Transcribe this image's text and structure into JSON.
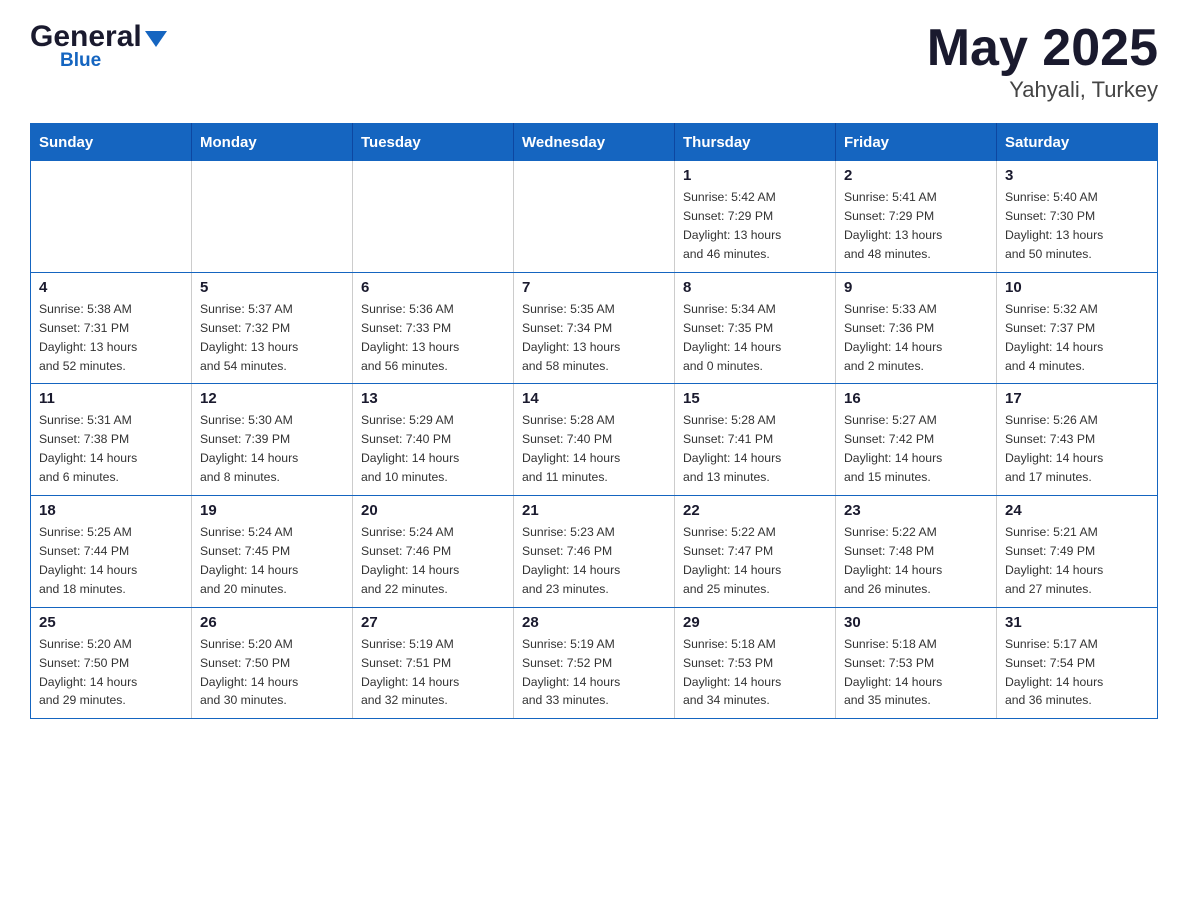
{
  "header": {
    "logo_general": "General",
    "logo_blue": "Blue",
    "month": "May 2025",
    "location": "Yahyali, Turkey"
  },
  "days_of_week": [
    "Sunday",
    "Monday",
    "Tuesday",
    "Wednesday",
    "Thursday",
    "Friday",
    "Saturday"
  ],
  "weeks": [
    [
      {
        "day": "",
        "info": ""
      },
      {
        "day": "",
        "info": ""
      },
      {
        "day": "",
        "info": ""
      },
      {
        "day": "",
        "info": ""
      },
      {
        "day": "1",
        "info": "Sunrise: 5:42 AM\nSunset: 7:29 PM\nDaylight: 13 hours\nand 46 minutes."
      },
      {
        "day": "2",
        "info": "Sunrise: 5:41 AM\nSunset: 7:29 PM\nDaylight: 13 hours\nand 48 minutes."
      },
      {
        "day": "3",
        "info": "Sunrise: 5:40 AM\nSunset: 7:30 PM\nDaylight: 13 hours\nand 50 minutes."
      }
    ],
    [
      {
        "day": "4",
        "info": "Sunrise: 5:38 AM\nSunset: 7:31 PM\nDaylight: 13 hours\nand 52 minutes."
      },
      {
        "day": "5",
        "info": "Sunrise: 5:37 AM\nSunset: 7:32 PM\nDaylight: 13 hours\nand 54 minutes."
      },
      {
        "day": "6",
        "info": "Sunrise: 5:36 AM\nSunset: 7:33 PM\nDaylight: 13 hours\nand 56 minutes."
      },
      {
        "day": "7",
        "info": "Sunrise: 5:35 AM\nSunset: 7:34 PM\nDaylight: 13 hours\nand 58 minutes."
      },
      {
        "day": "8",
        "info": "Sunrise: 5:34 AM\nSunset: 7:35 PM\nDaylight: 14 hours\nand 0 minutes."
      },
      {
        "day": "9",
        "info": "Sunrise: 5:33 AM\nSunset: 7:36 PM\nDaylight: 14 hours\nand 2 minutes."
      },
      {
        "day": "10",
        "info": "Sunrise: 5:32 AM\nSunset: 7:37 PM\nDaylight: 14 hours\nand 4 minutes."
      }
    ],
    [
      {
        "day": "11",
        "info": "Sunrise: 5:31 AM\nSunset: 7:38 PM\nDaylight: 14 hours\nand 6 minutes."
      },
      {
        "day": "12",
        "info": "Sunrise: 5:30 AM\nSunset: 7:39 PM\nDaylight: 14 hours\nand 8 minutes."
      },
      {
        "day": "13",
        "info": "Sunrise: 5:29 AM\nSunset: 7:40 PM\nDaylight: 14 hours\nand 10 minutes."
      },
      {
        "day": "14",
        "info": "Sunrise: 5:28 AM\nSunset: 7:40 PM\nDaylight: 14 hours\nand 11 minutes."
      },
      {
        "day": "15",
        "info": "Sunrise: 5:28 AM\nSunset: 7:41 PM\nDaylight: 14 hours\nand 13 minutes."
      },
      {
        "day": "16",
        "info": "Sunrise: 5:27 AM\nSunset: 7:42 PM\nDaylight: 14 hours\nand 15 minutes."
      },
      {
        "day": "17",
        "info": "Sunrise: 5:26 AM\nSunset: 7:43 PM\nDaylight: 14 hours\nand 17 minutes."
      }
    ],
    [
      {
        "day": "18",
        "info": "Sunrise: 5:25 AM\nSunset: 7:44 PM\nDaylight: 14 hours\nand 18 minutes."
      },
      {
        "day": "19",
        "info": "Sunrise: 5:24 AM\nSunset: 7:45 PM\nDaylight: 14 hours\nand 20 minutes."
      },
      {
        "day": "20",
        "info": "Sunrise: 5:24 AM\nSunset: 7:46 PM\nDaylight: 14 hours\nand 22 minutes."
      },
      {
        "day": "21",
        "info": "Sunrise: 5:23 AM\nSunset: 7:46 PM\nDaylight: 14 hours\nand 23 minutes."
      },
      {
        "day": "22",
        "info": "Sunrise: 5:22 AM\nSunset: 7:47 PM\nDaylight: 14 hours\nand 25 minutes."
      },
      {
        "day": "23",
        "info": "Sunrise: 5:22 AM\nSunset: 7:48 PM\nDaylight: 14 hours\nand 26 minutes."
      },
      {
        "day": "24",
        "info": "Sunrise: 5:21 AM\nSunset: 7:49 PM\nDaylight: 14 hours\nand 27 minutes."
      }
    ],
    [
      {
        "day": "25",
        "info": "Sunrise: 5:20 AM\nSunset: 7:50 PM\nDaylight: 14 hours\nand 29 minutes."
      },
      {
        "day": "26",
        "info": "Sunrise: 5:20 AM\nSunset: 7:50 PM\nDaylight: 14 hours\nand 30 minutes."
      },
      {
        "day": "27",
        "info": "Sunrise: 5:19 AM\nSunset: 7:51 PM\nDaylight: 14 hours\nand 32 minutes."
      },
      {
        "day": "28",
        "info": "Sunrise: 5:19 AM\nSunset: 7:52 PM\nDaylight: 14 hours\nand 33 minutes."
      },
      {
        "day": "29",
        "info": "Sunrise: 5:18 AM\nSunset: 7:53 PM\nDaylight: 14 hours\nand 34 minutes."
      },
      {
        "day": "30",
        "info": "Sunrise: 5:18 AM\nSunset: 7:53 PM\nDaylight: 14 hours\nand 35 minutes."
      },
      {
        "day": "31",
        "info": "Sunrise: 5:17 AM\nSunset: 7:54 PM\nDaylight: 14 hours\nand 36 minutes."
      }
    ]
  ]
}
